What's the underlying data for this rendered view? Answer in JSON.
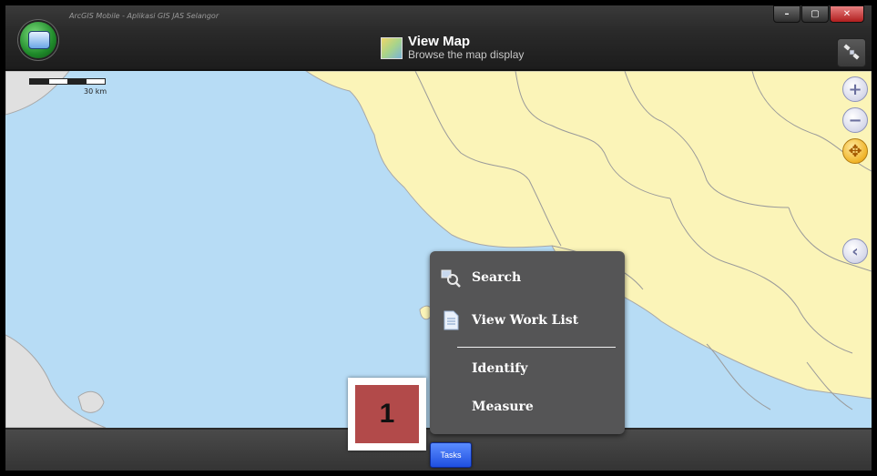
{
  "window": {
    "app_title": "ArcGIS Mobile - Aplikasi GIS JAS Selangor",
    "minimize_label": "–",
    "restore_label": "▢",
    "close_label": "✕"
  },
  "header": {
    "view_title": "View Map",
    "view_subtitle": "Browse the map display"
  },
  "map": {
    "scale_label": "30 km",
    "zoom_in_label": "+",
    "zoom_out_label": "−",
    "pan_label": "✥",
    "collapse_label": "‹",
    "colors": {
      "water": "#b7dcf5",
      "land": "#fbf4b8",
      "boundary": "#9a9a9a"
    }
  },
  "tasks_menu": {
    "items": [
      {
        "label": "Search",
        "icon": "search-icon"
      },
      {
        "label": "View Work List",
        "icon": "document-icon"
      },
      {
        "label": "Identify"
      },
      {
        "label": "Measure"
      }
    ]
  },
  "bottom_bar": {
    "tasks_button_label": "Tasks"
  },
  "callout": {
    "number": "1"
  }
}
